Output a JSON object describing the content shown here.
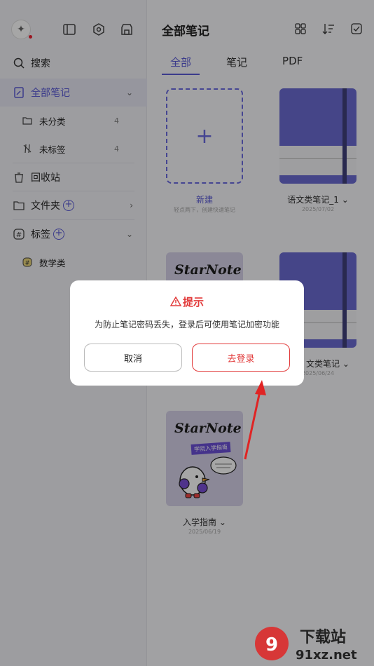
{
  "sidebar": {
    "search_label": "搜索",
    "items": [
      {
        "label": "全部笔记",
        "active": true
      },
      {
        "label": "未分类",
        "count": "4"
      },
      {
        "label": "未标签",
        "count": "4"
      },
      {
        "label": "回收站"
      },
      {
        "label": "文件夹"
      },
      {
        "label": "标签"
      },
      {
        "label": "数学类"
      }
    ]
  },
  "main": {
    "title": "全部笔记",
    "tabs": [
      {
        "label": "全部",
        "active": true
      },
      {
        "label": "笔记"
      },
      {
        "label": "PDF"
      }
    ],
    "cards": [
      {
        "label": "新建",
        "sub": "轻点两下，创建快速笔记"
      },
      {
        "label": "语文类笔记_1",
        "date": "2025/07/02"
      },
      {
        "label": "文类笔记",
        "date": "2025/06/24"
      },
      {
        "label": "入学指南",
        "date": "2025/06/19",
        "cover_title": "StarNote",
        "cover_tag": "学院入学指南"
      }
    ]
  },
  "modal": {
    "title": "提示",
    "message": "为防止笔记密码丢失，登录后可使用笔记加密功能",
    "cancel_label": "取消",
    "login_label": "去登录"
  },
  "watermark": {
    "text_top": "下载站",
    "text_bottom": "91xz.net"
  },
  "colors": {
    "accent": "#5b5bd6",
    "alert": "#e23b3b"
  }
}
